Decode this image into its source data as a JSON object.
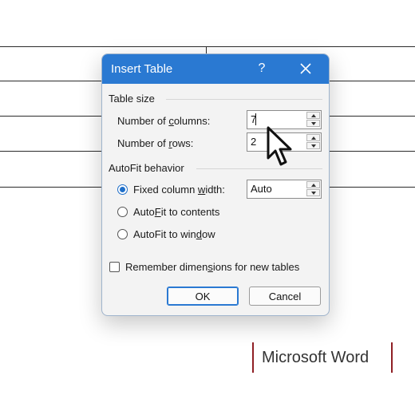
{
  "dialog": {
    "title": "Insert Table",
    "help_label": "?",
    "table_size_label": "Table size",
    "columns_label_pre": "Number of ",
    "columns_label_u": "c",
    "columns_label_post": "olumns:",
    "columns_value": "7",
    "rows_label_pre": "Number of ",
    "rows_label_u": "r",
    "rows_label_post": "ows:",
    "rows_value": "2",
    "autofit_label": "AutoFit behavior",
    "fixed_pre": "Fixed column ",
    "fixed_u": "w",
    "fixed_post": "idth:",
    "fixed_value": "Auto",
    "contents_pre": "Auto",
    "contents_u": "F",
    "contents_post": "it to contents",
    "window_pre": "AutoFit to win",
    "window_u": "d",
    "window_post": "ow",
    "remember_pre": "Remember dimen",
    "remember_u": "s",
    "remember_post": "ions for new tables",
    "ok_label": "OK",
    "cancel_label": "Cancel",
    "accent_color": "#2a79d2"
  },
  "watermark": {
    "text": "Microsoft Word",
    "bar_color": "#8f1f24"
  }
}
